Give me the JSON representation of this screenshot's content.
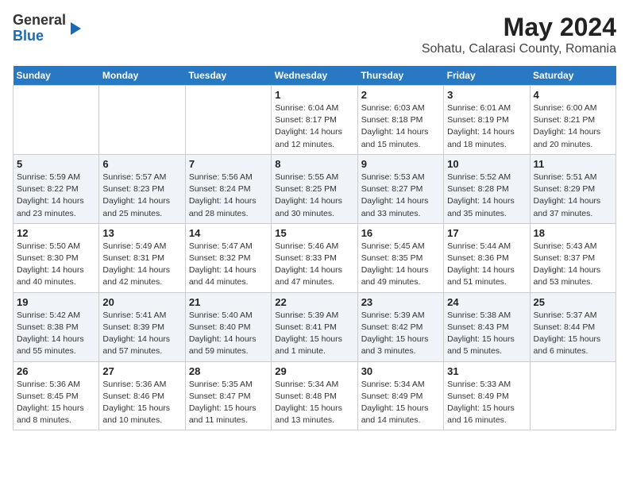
{
  "logo": {
    "line1": "General",
    "line2": "Blue"
  },
  "title": "May 2024",
  "subtitle": "Sohatu, Calarasi County, Romania",
  "days_of_week": [
    "Sunday",
    "Monday",
    "Tuesday",
    "Wednesday",
    "Thursday",
    "Friday",
    "Saturday"
  ],
  "weeks": [
    [
      {
        "day": "",
        "info": ""
      },
      {
        "day": "",
        "info": ""
      },
      {
        "day": "",
        "info": ""
      },
      {
        "day": "1",
        "info": "Sunrise: 6:04 AM\nSunset: 8:17 PM\nDaylight: 14 hours and 12 minutes."
      },
      {
        "day": "2",
        "info": "Sunrise: 6:03 AM\nSunset: 8:18 PM\nDaylight: 14 hours and 15 minutes."
      },
      {
        "day": "3",
        "info": "Sunrise: 6:01 AM\nSunset: 8:19 PM\nDaylight: 14 hours and 18 minutes."
      },
      {
        "day": "4",
        "info": "Sunrise: 6:00 AM\nSunset: 8:21 PM\nDaylight: 14 hours and 20 minutes."
      }
    ],
    [
      {
        "day": "5",
        "info": "Sunrise: 5:59 AM\nSunset: 8:22 PM\nDaylight: 14 hours and 23 minutes."
      },
      {
        "day": "6",
        "info": "Sunrise: 5:57 AM\nSunset: 8:23 PM\nDaylight: 14 hours and 25 minutes."
      },
      {
        "day": "7",
        "info": "Sunrise: 5:56 AM\nSunset: 8:24 PM\nDaylight: 14 hours and 28 minutes."
      },
      {
        "day": "8",
        "info": "Sunrise: 5:55 AM\nSunset: 8:25 PM\nDaylight: 14 hours and 30 minutes."
      },
      {
        "day": "9",
        "info": "Sunrise: 5:53 AM\nSunset: 8:27 PM\nDaylight: 14 hours and 33 minutes."
      },
      {
        "day": "10",
        "info": "Sunrise: 5:52 AM\nSunset: 8:28 PM\nDaylight: 14 hours and 35 minutes."
      },
      {
        "day": "11",
        "info": "Sunrise: 5:51 AM\nSunset: 8:29 PM\nDaylight: 14 hours and 37 minutes."
      }
    ],
    [
      {
        "day": "12",
        "info": "Sunrise: 5:50 AM\nSunset: 8:30 PM\nDaylight: 14 hours and 40 minutes."
      },
      {
        "day": "13",
        "info": "Sunrise: 5:49 AM\nSunset: 8:31 PM\nDaylight: 14 hours and 42 minutes."
      },
      {
        "day": "14",
        "info": "Sunrise: 5:47 AM\nSunset: 8:32 PM\nDaylight: 14 hours and 44 minutes."
      },
      {
        "day": "15",
        "info": "Sunrise: 5:46 AM\nSunset: 8:33 PM\nDaylight: 14 hours and 47 minutes."
      },
      {
        "day": "16",
        "info": "Sunrise: 5:45 AM\nSunset: 8:35 PM\nDaylight: 14 hours and 49 minutes."
      },
      {
        "day": "17",
        "info": "Sunrise: 5:44 AM\nSunset: 8:36 PM\nDaylight: 14 hours and 51 minutes."
      },
      {
        "day": "18",
        "info": "Sunrise: 5:43 AM\nSunset: 8:37 PM\nDaylight: 14 hours and 53 minutes."
      }
    ],
    [
      {
        "day": "19",
        "info": "Sunrise: 5:42 AM\nSunset: 8:38 PM\nDaylight: 14 hours and 55 minutes."
      },
      {
        "day": "20",
        "info": "Sunrise: 5:41 AM\nSunset: 8:39 PM\nDaylight: 14 hours and 57 minutes."
      },
      {
        "day": "21",
        "info": "Sunrise: 5:40 AM\nSunset: 8:40 PM\nDaylight: 14 hours and 59 minutes."
      },
      {
        "day": "22",
        "info": "Sunrise: 5:39 AM\nSunset: 8:41 PM\nDaylight: 15 hours and 1 minute."
      },
      {
        "day": "23",
        "info": "Sunrise: 5:39 AM\nSunset: 8:42 PM\nDaylight: 15 hours and 3 minutes."
      },
      {
        "day": "24",
        "info": "Sunrise: 5:38 AM\nSunset: 8:43 PM\nDaylight: 15 hours and 5 minutes."
      },
      {
        "day": "25",
        "info": "Sunrise: 5:37 AM\nSunset: 8:44 PM\nDaylight: 15 hours and 6 minutes."
      }
    ],
    [
      {
        "day": "26",
        "info": "Sunrise: 5:36 AM\nSunset: 8:45 PM\nDaylight: 15 hours and 8 minutes."
      },
      {
        "day": "27",
        "info": "Sunrise: 5:36 AM\nSunset: 8:46 PM\nDaylight: 15 hours and 10 minutes."
      },
      {
        "day": "28",
        "info": "Sunrise: 5:35 AM\nSunset: 8:47 PM\nDaylight: 15 hours and 11 minutes."
      },
      {
        "day": "29",
        "info": "Sunrise: 5:34 AM\nSunset: 8:48 PM\nDaylight: 15 hours and 13 minutes."
      },
      {
        "day": "30",
        "info": "Sunrise: 5:34 AM\nSunset: 8:49 PM\nDaylight: 15 hours and 14 minutes."
      },
      {
        "day": "31",
        "info": "Sunrise: 5:33 AM\nSunset: 8:49 PM\nDaylight: 15 hours and 16 minutes."
      },
      {
        "day": "",
        "info": ""
      }
    ]
  ]
}
